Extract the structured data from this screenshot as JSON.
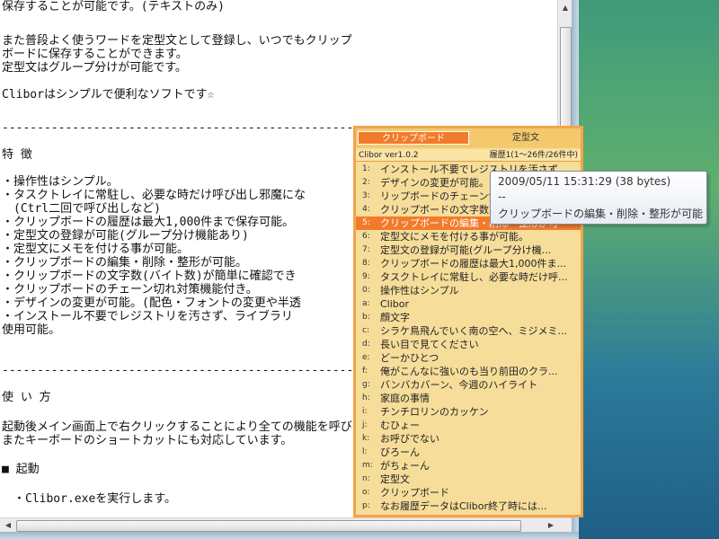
{
  "text_window": {
    "lines": [
      "保存することが可能です。(テキストのみ)",
      "",
      "また普段よく使うワードを定型文として登録し、いつでもクリップ",
      "ボードに保存することができます。",
      "定型文はグループ分けが可能です。",
      "",
      "Cliborはシンプルで便利なソフトです☆",
      "",
      "-------------------------------------------------------------------------------------",
      "",
      "特 徴",
      "",
      "・操作性はシンプル。",
      "・タスクトレイに常駐し、必要な時だけ呼び出し邪魔にな",
      "　(Ctrl二回で呼び出しなど)",
      "・クリップボードの履歴は最大1,000件まで保存可能。",
      "・定型文の登録が可能(グループ分け機能あり)",
      "・定型文にメモを付ける事が可能。",
      "・クリップボードの編集・削除・整形が可能。",
      "・クリップボードの文字数(バイト数)が簡単に確認でき",
      "・クリップボードのチェーン切れ対策機能付き。",
      "・デザインの変更が可能。(配色・フォントの変更や半透",
      "・インストール不要でレジストリを汚さず、ライブラリ",
      "使用可能。",
      "",
      "-------------------------------------------------------------------------------------",
      "",
      "使 い 方",
      "",
      "起動後メイン画面上で右クリックすることにより全ての機能を呼び出すことができます。",
      "またキーボードのショートカットにも対応しています。",
      "",
      "■ 起動",
      "",
      "　・Clibor.exeを実行します。"
    ]
  },
  "clibor": {
    "tabs": {
      "clipboard": "クリップボード",
      "fixed": "定型文"
    },
    "status": {
      "version": "Clibor ver1.0.2",
      "history": "履歴1(1～26件/26件中)"
    },
    "items": [
      {
        "key": "1:",
        "text": "インストール不要でレジストリを汚さず"
      },
      {
        "key": "2:",
        "text": "デザインの変更が可能。"
      },
      {
        "key": "3:",
        "text": "リップボードのチェーン切"
      },
      {
        "key": "4:",
        "text": "クリップボードの文字数(バ"
      },
      {
        "key": "5:",
        "text": "クリップボードの編集・削除・整形が可"
      },
      {
        "key": "6:",
        "text": "定型文にメモを付ける事が可能。"
      },
      {
        "key": "7:",
        "text": "定型文の登録が可能(グループ分け機..."
      },
      {
        "key": "8:",
        "text": "クリップボードの履歴は最大1,000件ま..."
      },
      {
        "key": "9:",
        "text": "タスクトレイに常駐し、必要な時だけ呼..."
      },
      {
        "key": "0:",
        "text": "操作性はシンプル"
      },
      {
        "key": "a:",
        "text": "Clibor"
      },
      {
        "key": "b:",
        "text": "顔文字"
      },
      {
        "key": "c:",
        "text": "シラケ鳥飛んでいく南の空へ、ミジメミ..."
      },
      {
        "key": "d:",
        "text": "長い目で見てください"
      },
      {
        "key": "e:",
        "text": "どーかひとつ"
      },
      {
        "key": "f:",
        "text": "俺がこんなに強いのも当り前田のクラ..."
      },
      {
        "key": "g:",
        "text": "バンバカバーン、今週のハイライト"
      },
      {
        "key": "h:",
        "text": "家庭の事情"
      },
      {
        "key": "i:",
        "text": "チンチロリンのカッケン"
      },
      {
        "key": "j:",
        "text": "むひょー"
      },
      {
        "key": "k:",
        "text": "お呼びでない"
      },
      {
        "key": "l:",
        "text": "びろーん"
      },
      {
        "key": "m:",
        "text": "がちょーん"
      },
      {
        "key": "n:",
        "text": "定型文"
      },
      {
        "key": "o:",
        "text": "クリップボード"
      },
      {
        "key": "p:",
        "text": "なお履歴データはClibor終了時には..."
      }
    ],
    "selected_index": 4
  },
  "tooltip": {
    "timestamp": "2009/05/11 15:31:29 (38 bytes)",
    "separator": "--",
    "content": "クリップボードの編集・削除・整形が可能"
  },
  "colors": {
    "popup_bg": "#f6dd9a",
    "popup_border": "#f3a44a",
    "selection": "#f27b2b"
  }
}
